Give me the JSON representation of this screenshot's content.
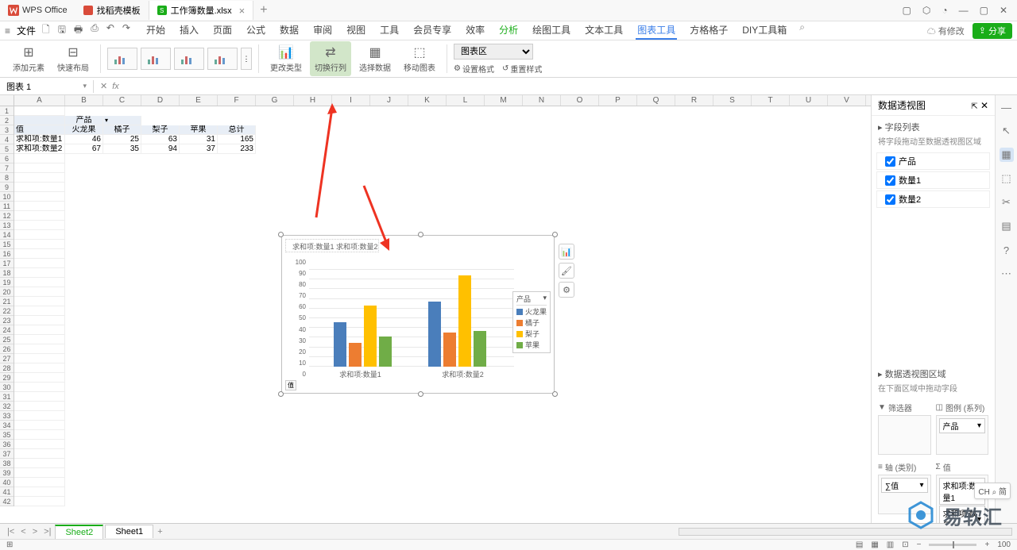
{
  "app": {
    "name": "WPS Office"
  },
  "tabs": [
    {
      "icon": "w",
      "label": "找稻壳模板"
    },
    {
      "icon": "s",
      "label": "工作簿数量.xlsx"
    }
  ],
  "menu": {
    "file": "文件",
    "items": [
      "开始",
      "插入",
      "页面",
      "公式",
      "数据",
      "审阅",
      "视图",
      "工具",
      "会员专享",
      "效率",
      "分析",
      "绘图工具",
      "文本工具",
      "图表工具",
      "方格格子",
      "DIY工具箱"
    ],
    "active_green_idx": 10,
    "active_blue_idx": 13,
    "modify": "有修改",
    "share": "分享"
  },
  "ribbon": {
    "add_element": "添加元素",
    "quick_layout": "快速布局",
    "change_type": "更改类型",
    "switch_rowcol": "切换行列",
    "select_data": "选择数据",
    "move_chart": "移动图表",
    "chart_area": "图表区",
    "set_format": "设置格式",
    "reset_style": "重置样式"
  },
  "namebox": "图表 1",
  "fx": "fx",
  "columns": [
    "A",
    "B",
    "C",
    "D",
    "E",
    "F",
    "G",
    "H",
    "I",
    "J",
    "K",
    "L",
    "M",
    "N",
    "O",
    "P",
    "Q",
    "R",
    "S",
    "T",
    "U",
    "V"
  ],
  "pivot": {
    "r2_b": "产品",
    "r3": [
      "值",
      "火龙果",
      "橘子",
      "梨子",
      "苹果",
      "总计"
    ],
    "r4": [
      "求和项:数量1",
      "46",
      "25",
      "63",
      "31",
      "165"
    ],
    "r5": [
      "求和项:数量2",
      "67",
      "35",
      "94",
      "37",
      "233"
    ]
  },
  "chart_data": {
    "type": "bar",
    "legend_top": "求和项:数量1 求和项:数量2",
    "categories": [
      "求和项:数量1",
      "求和项:数量2"
    ],
    "series": [
      {
        "name": "火龙果",
        "color": "#4a7ebb",
        "values": [
          46,
          67
        ]
      },
      {
        "name": "橘子",
        "color": "#ed7d31",
        "values": [
          25,
          35
        ]
      },
      {
        "name": "梨子",
        "color": "#ffc000",
        "values": [
          63,
          94
        ]
      },
      {
        "name": "苹果",
        "color": "#70ad47",
        "values": [
          31,
          37
        ]
      }
    ],
    "ylim": [
      0,
      100
    ],
    "yticks": [
      0,
      10,
      20,
      30,
      40,
      50,
      60,
      70,
      80,
      90,
      100
    ],
    "side_legend_title": "产品",
    "corner_tag": "值"
  },
  "right_panel": {
    "title": "数据透视图",
    "field_list": "字段列表",
    "hint": "将字段拖动至数据透视图区域",
    "fields": [
      "产品",
      "数量1",
      "数量2"
    ],
    "area_title": "数据透视图区域",
    "area_hint": "在下面区域中拖动字段",
    "filter": "筛选器",
    "legend": "图例 (系列)",
    "axis": "轴 (类别)",
    "values": "值",
    "legend_chip": "产品",
    "axis_chip": "∑值",
    "value_chips": [
      "求和项:数量1",
      "求和项:数量2"
    ]
  },
  "sheets": {
    "active": "Sheet2",
    "other": "Sheet1"
  },
  "status": {
    "zoom": "100"
  },
  "ime": "CH ⌕ 简",
  "watermark": "易软汇"
}
